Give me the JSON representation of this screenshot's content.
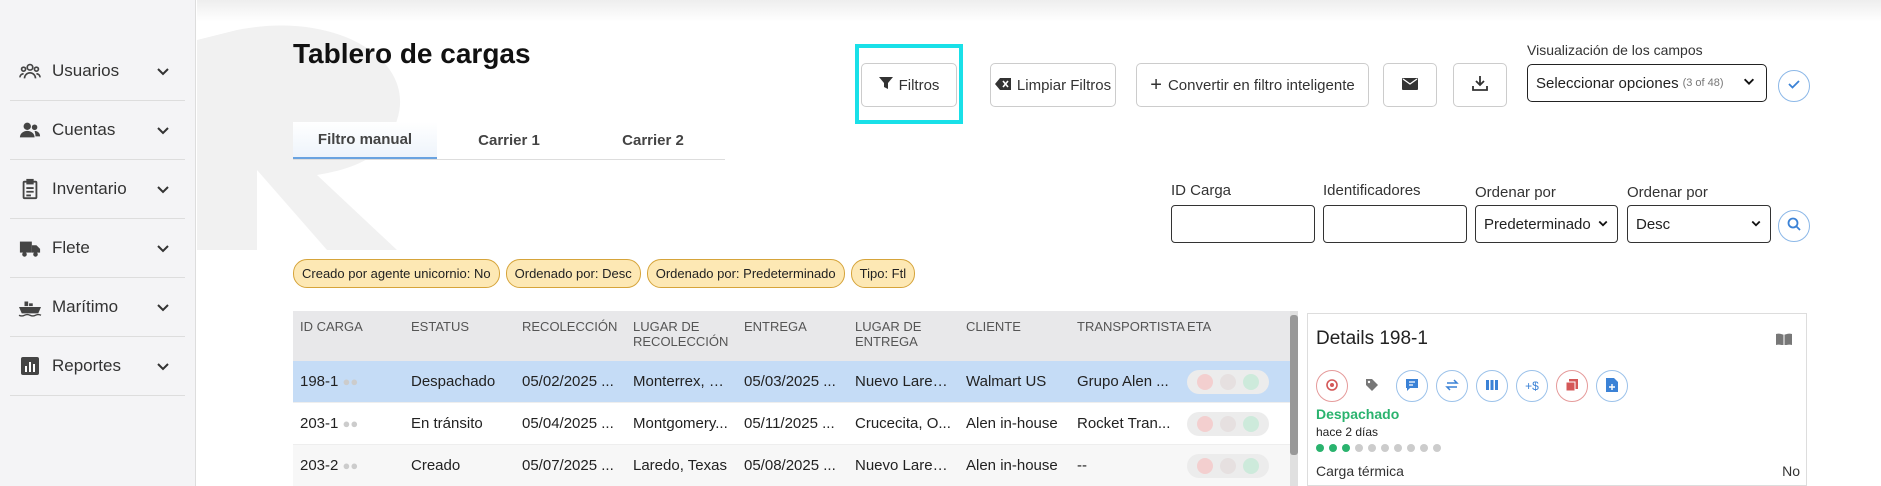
{
  "sidebar": {
    "items": [
      {
        "label": "Usuarios",
        "icon": "users-icon"
      },
      {
        "label": "Cuentas",
        "icon": "accounts-icon"
      },
      {
        "label": "Inventario",
        "icon": "clipboard-icon"
      },
      {
        "label": "Flete",
        "icon": "truck-icon"
      },
      {
        "label": "Marítimo",
        "icon": "ship-icon"
      },
      {
        "label": "Reportes",
        "icon": "chart-icon"
      }
    ]
  },
  "page": {
    "title": "Tablero de cargas"
  },
  "toolbar": {
    "filters_label": "Filtros",
    "clear_filters_label": "Limpiar Filtros",
    "convert_label": "Convertir en filtro inteligente",
    "fields_label": "Visualización de los campos",
    "fields_select_value": "Seleccionar opciones",
    "fields_select_count": "(3 of 48)"
  },
  "tabs": [
    "Filtro manual",
    "Carrier 1",
    "Carrier 2"
  ],
  "search": {
    "id_label": "ID Carga",
    "identifiers_label": "Identificadores",
    "order_label_1": "Ordenar por",
    "order_value_1": "Predeterminado",
    "order_label_2": "Ordenar por",
    "order_value_2": "Desc"
  },
  "chips": [
    "Creado por agente unicornio: No",
    "Ordenado por: Desc",
    "Ordenado por: Predeterminado",
    "Tipo: Ftl"
  ],
  "table": {
    "headers": [
      "ID CARGA",
      "ESTATUS",
      "RECOLECCIÓN",
      "LUGAR DE RECOLECCIÓN",
      "ENTREGA",
      "LUGAR DE ENTREGA",
      "CLIENTE",
      "TRANSPORTISTA",
      "ETA"
    ],
    "rows": [
      [
        "198-1",
        "Despachado",
        "05/02/2025 ...",
        "Monterrex, N...",
        "05/03/2025 ...",
        "Nuevo Lared...",
        "Walmart US",
        "Grupo Alen ..."
      ],
      [
        "203-1",
        "En tránsito",
        "05/04/2025 ...",
        "Montgomery...",
        "05/11/2025 ...",
        "Crucecita, O...",
        "Alen in-house",
        "Rocket Tran..."
      ],
      [
        "203-2",
        "Creado",
        "05/07/2025 ...",
        "Laredo, Texas",
        "05/08/2025 ...",
        "Nuevo Lared...",
        "Alen in-house",
        "--"
      ]
    ]
  },
  "details": {
    "title": "Details 198-1",
    "status": "Despachado",
    "ago": "hace 2 días",
    "progress_steps_total": 10,
    "progress_steps_done": 3,
    "prop_label": "Carga térmica",
    "prop_value": "No"
  },
  "colors": {
    "accent": "#3b82d6",
    "highlight": "#19e0e8",
    "chip": "#fde8b4",
    "status_green": "#2ab36e",
    "selected_row": "#c5dcf6"
  }
}
